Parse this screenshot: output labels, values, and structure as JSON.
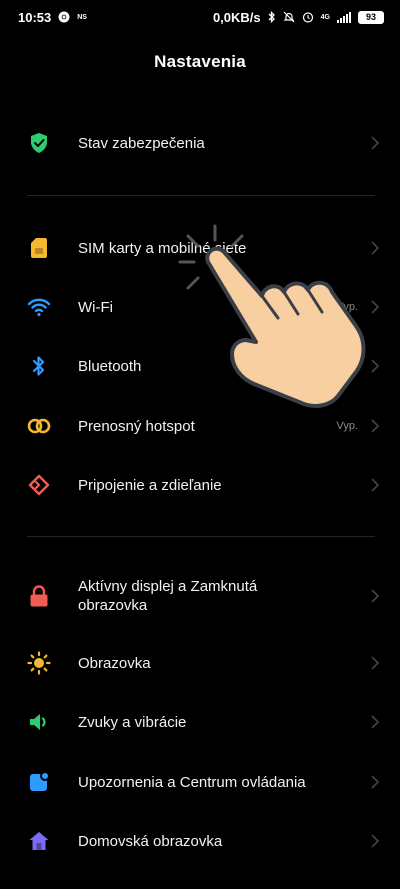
{
  "status_bar": {
    "time": "10:53",
    "ns_label": "NS",
    "speed": "0,0KB/s",
    "network": "4G",
    "battery": "93"
  },
  "header": {
    "title": "Nastavenia"
  },
  "rows": [
    {
      "label": "Stav zabezpečenia",
      "value": "",
      "icon": "shield-check-icon",
      "color": "#2ecc71"
    },
    {
      "label": "SIM karty a mobilné siete",
      "value": "",
      "icon": "sim-card-icon",
      "color": "#f5b82e"
    },
    {
      "label": "Wi-Fi",
      "value": "Vyp.",
      "icon": "wifi-icon",
      "color": "#2f9bff"
    },
    {
      "label": "Bluetooth",
      "value": "",
      "icon": "bluetooth-icon",
      "color": "#2f9bff"
    },
    {
      "label": "Prenosný hotspot",
      "value": "Vyp.",
      "icon": "hotspot-icon",
      "color": "#f5b82e"
    },
    {
      "label": "Pripojenie a zdieľanie",
      "value": "",
      "icon": "connection-sharing-icon",
      "color": "#f25c54"
    },
    {
      "label": "Aktívny displej a Zamknutá obrazovka",
      "value": "",
      "icon": "lock-icon",
      "color": "#f25c54"
    },
    {
      "label": "Obrazovka",
      "value": "",
      "icon": "sun-icon",
      "color": "#f5b82e"
    },
    {
      "label": "Zvuky a vibrácie",
      "value": "",
      "icon": "speaker-icon",
      "color": "#2ecc71"
    },
    {
      "label": "Upozornenia a Centrum ovládania",
      "value": "",
      "icon": "notification-icon",
      "color": "#2f9bff"
    },
    {
      "label": "Domovská obrazovka",
      "value": "",
      "icon": "home-icon",
      "color": "#7b6cf6"
    }
  ]
}
